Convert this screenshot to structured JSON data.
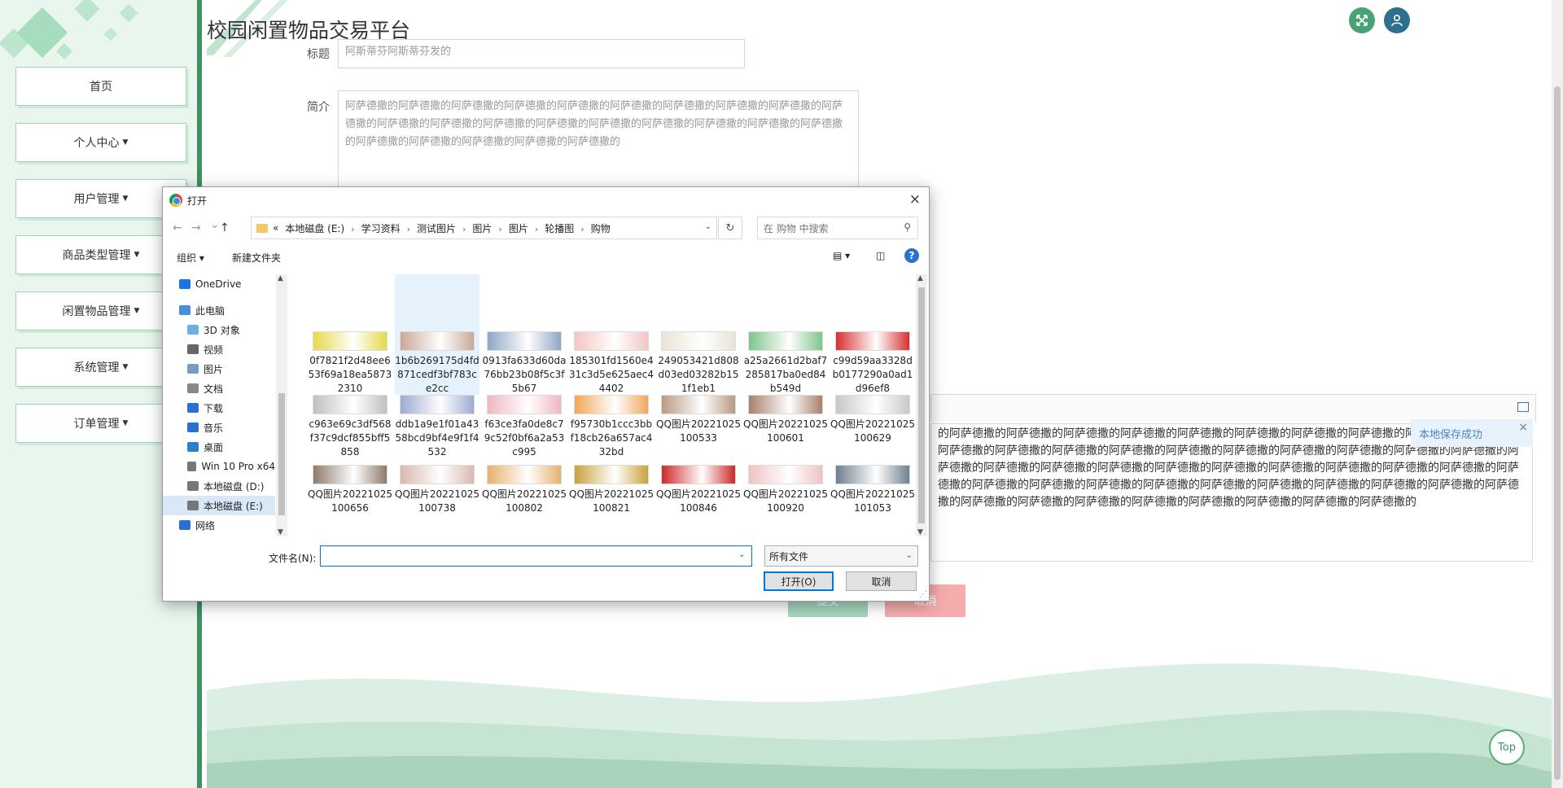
{
  "app": {
    "title": "校园闲置物品交易平台",
    "icons": {
      "fullscreen": "fullscreen-icon",
      "user": "user-icon"
    },
    "colors": {
      "primary": "#3f8f62",
      "accent": "#5aaa7e",
      "light": "#e8f6ee",
      "fullscreen_btn": "#49a274",
      "user_btn": "#2e6f8e"
    }
  },
  "sidebar": {
    "items": [
      {
        "label": "首页",
        "has_caret": false
      },
      {
        "label": "个人中心",
        "has_caret": true
      },
      {
        "label": "用户管理",
        "has_caret": true
      },
      {
        "label": "商品类型管理",
        "has_caret": true
      },
      {
        "label": "闲置物品管理",
        "has_caret": true
      },
      {
        "label": "系统管理",
        "has_caret": true
      },
      {
        "label": "订单管理",
        "has_caret": true
      }
    ]
  },
  "form": {
    "title_label": "标题",
    "title_value": "阿斯蒂芬阿斯蒂芬发的",
    "intro_label": "简介",
    "intro_value": "阿萨德撒的阿萨德撒的阿萨德撒的阿萨德撒的阿萨德撒的阿萨德撒的阿萨德撒的阿萨德撒的阿萨德撒的阿萨德撒的阿萨德撒的阿萨德撒的阿萨德撒的阿萨德撒的阿萨德撒的阿萨德撒的阿萨德撒的阿萨德撒的阿萨德撒的阿萨德撒的阿萨德撒的阿萨德撒的阿萨德撒的阿萨德撒的",
    "detail_value": "的阿萨德撒的阿萨德撒的阿萨德撒的阿萨德撒的阿萨德撒的阿萨德撒的阿萨德撒的阿萨德撒的阿萨德撒的阿萨德撒的阿萨德撒的阿萨德撒的阿萨德撒的阿萨德撒的阿萨德撒的阿萨德撒的阿萨德撒的阿萨德撒的阿萨德撒的阿萨德撒的阿萨德撒的阿萨德撒的阿萨德撒的阿萨德撒的阿萨德撒的阿萨德撒的阿萨德撒的阿萨德撒的阿萨德撒的阿萨德撒的阿萨德撒的阿萨德撒的阿萨德撒的阿萨德撒的阿萨德撒的阿萨德撒的阿萨德撒的阿萨德撒的阿萨德撒的阿萨德撒的阿萨德撒的阿萨德撒的阿萨德撒的阿萨德撒的阿萨德撒的阿萨德撒的阿萨德撒的阿萨德撒的阿萨德撒的",
    "submit_label": "提交",
    "cancel_label": "取消",
    "submit_color": "#5cb58a",
    "cancel_color": "#f28a8a"
  },
  "toast": {
    "text": "本地保存成功",
    "close": "×"
  },
  "top_button": {
    "label": "Top"
  },
  "dialog": {
    "title": "打开",
    "close": "×",
    "nav": {
      "back": "←",
      "forward": "→",
      "recent": "⌄",
      "up": "↑"
    },
    "path": [
      "本地磁盘 (E:)",
      "学习资料",
      "测试图片",
      "图片",
      "图片",
      "轮播图",
      "购物"
    ],
    "path_prefix": "«",
    "search_placeholder": "在 购物 中搜索",
    "toolbar": {
      "organize": "组织 ▾",
      "new_folder": "新建文件夹",
      "help": "?"
    },
    "tree": [
      {
        "label": "OneDrive",
        "icon": "cloud-icon",
        "indent": 1
      },
      {
        "label": "此电脑",
        "icon": "computer-icon",
        "indent": 1
      },
      {
        "label": "3D 对象",
        "icon": "cube-icon",
        "indent": 2
      },
      {
        "label": "视频",
        "icon": "video-icon",
        "indent": 2
      },
      {
        "label": "图片",
        "icon": "picture-icon",
        "indent": 2
      },
      {
        "label": "文档",
        "icon": "document-icon",
        "indent": 2
      },
      {
        "label": "下载",
        "icon": "download-icon",
        "indent": 2
      },
      {
        "label": "音乐",
        "icon": "music-icon",
        "indent": 2
      },
      {
        "label": "桌面",
        "icon": "desktop-icon",
        "indent": 2
      },
      {
        "label": "Win 10 Pro x64",
        "icon": "drive-icon",
        "indent": 2
      },
      {
        "label": "本地磁盘 (D:)",
        "icon": "drive-icon",
        "indent": 2
      },
      {
        "label": "本地磁盘 (E:)",
        "icon": "drive-icon",
        "indent": 2,
        "selected": true
      },
      {
        "label": "网络",
        "icon": "network-icon",
        "indent": 1
      }
    ],
    "files": [
      {
        "name": "0f7821f2d48ee653f69a18ea58732310",
        "color": "#e6d94a"
      },
      {
        "name": "1b6b269175d4fd871cedf3bf783ce2cc",
        "color": "#c9a89a",
        "hover": true
      },
      {
        "name": "0913fa633d60da76bb23b08f5c3f5b67",
        "color": "#8fa6c6"
      },
      {
        "name": "185301fd1560e431c3d5e625aec44402",
        "color": "#f2c6c2"
      },
      {
        "name": "249053421d808d03ed03282b151f1eb1",
        "color": "#e9e3d5"
      },
      {
        "name": "a25a2661d2baf7285817ba0ed84b549d",
        "color": "#7ec58a"
      },
      {
        "name": "c99d59aa3328db0177290a0ad1d96ef8",
        "color": "#d8302e"
      },
      {
        "name": "c963e69c3df568f37c9dcf855bff5858",
        "color": "#c0c0c0"
      },
      {
        "name": "ddb1a9e1f01a4358bcd9bf4e9f1f4532",
        "color": "#9fa9d3"
      },
      {
        "name": "f63ce3fa0de8c79c52f0bf6a2a53c995",
        "color": "#f0b6c0"
      },
      {
        "name": "f95730b1ccc3bbf18cb26a657ac432bd",
        "color": "#f2a65a"
      },
      {
        "name": "QQ图片20221025100533",
        "color": "#b89a82"
      },
      {
        "name": "QQ图片20221025100601",
        "color": "#a9806a"
      },
      {
        "name": "QQ图片20221025100629",
        "color": "#c8c8c8"
      },
      {
        "name": "QQ图片20221025100656",
        "color": "#8f7a6a"
      },
      {
        "name": "QQ图片20221025100738",
        "color": "#d9b9b0"
      },
      {
        "name": "QQ图片20221025100802",
        "color": "#e6b16f"
      },
      {
        "name": "QQ图片20221025100821",
        "color": "#c8a23e"
      },
      {
        "name": "QQ图片20221025100846",
        "color": "#cc2a2a"
      },
      {
        "name": "QQ图片20221025100920",
        "color": "#f0c2c2"
      },
      {
        "name": "QQ图片20221025101053",
        "color": "#6f7f8f"
      }
    ],
    "filename_label": "文件名(N):",
    "filename_value": "",
    "filetype_value": "所有文件",
    "open_label": "打开(O)",
    "cancel_label": "取消"
  }
}
